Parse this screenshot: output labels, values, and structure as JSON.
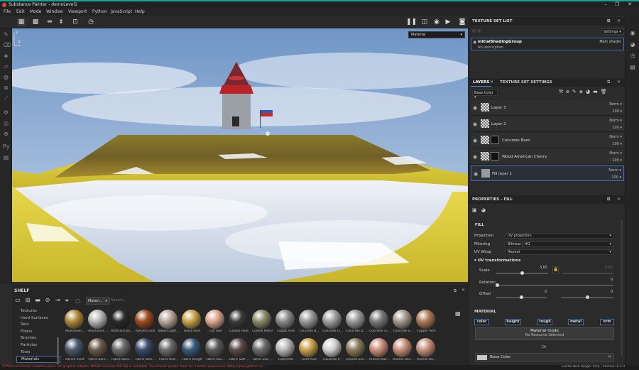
{
  "window": {
    "title": "Substance Painter - demoLevel1",
    "accent": "#1aa39a"
  },
  "menu": [
    "File",
    "Edit",
    "Mode",
    "Window",
    "Viewport",
    "Python",
    "JavaScript",
    "Help"
  ],
  "viewport": {
    "mode_select": "Material"
  },
  "shelf": {
    "title": "SHELF",
    "categories": [
      "Textures",
      "Hard Surfaces",
      "Skin",
      "Filters",
      "Brushes",
      "Particles",
      "Tools",
      "Materials"
    ],
    "selected_category": "Materials",
    "filter_chip": "Materi...",
    "search_placeholder": "Search...",
    "materials_row1": [
      "Aluminium...",
      "Aluminium ...",
      "Artificial Lea...",
      "Autumn Leaf",
      "Baked Light...",
      "Brass Pure",
      "Calf Skin",
      "Carbon Fiber",
      "Coated Metal",
      "Cobalt Pure",
      "Concrete B...",
      "Concrete Cl...",
      "Concrete D...",
      "Concrete Si...",
      "Concrete S...",
      "Copper Pure"
    ],
    "materials_row2": [
      "Denim Rivet",
      "Fabric Barn...",
      "Fabric Base...",
      "Fabric Deni...",
      "Fabric Knit...",
      "Fabric Rough",
      "Fabric Rou...",
      "Fabric Soft ...",
      "Fabric Suit ...",
      "Footprints",
      "Gold Pure",
      "Gouache P...",
      "Ground Gra...",
      "Human Bac...",
      "Human Bell...",
      "Human Bu..."
    ]
  },
  "status": {
    "message": "[GPUIssuesCheck] Installed driver for graphics adapter NVIDIA GeForce MX150 is outdated. You should update them for a better experience (http://www.geforce.co...",
    "cache_label": "Cache Disk Usage:",
    "cache_value": "95%",
    "version": "Version: 6.2.0"
  },
  "texture_set_list": {
    "title": "TEXTURE SET LIST",
    "settings_label": "Settings",
    "shading_group": "initialShadingGroup",
    "description": "No description",
    "shader": "Main shader"
  },
  "layers": {
    "tab_layers": "LAYERS",
    "tab_settings": "TEXTURE SET SETTINGS",
    "channel": "Base Color",
    "items": [
      {
        "name": "Layer 3",
        "blend": "Norm",
        "opacity": "100"
      },
      {
        "name": "Layer 2",
        "blend": "Norm",
        "opacity": "100"
      },
      {
        "name": "Concrete Bare",
        "blend": "Norm",
        "opacity": "100"
      },
      {
        "name": "Wood American Cherry",
        "blend": "Norm",
        "opacity": "100"
      },
      {
        "name": "Fill layer 1",
        "blend": "Norm",
        "opacity": "100"
      }
    ]
  },
  "properties": {
    "title": "PROPERTIES - FILL",
    "section_fill": "FILL",
    "projection_label": "Projection",
    "projection_value": "UV projection",
    "filtering_label": "Filtering",
    "filtering_value": "Bilinear | HQ",
    "uvwrap_label": "UV Wrap",
    "uvwrap_value": "Repeat",
    "uv_transform_title": "UV transformations",
    "scale_label": "Scale",
    "scale_value": "3.65",
    "scale_value2": "3.65",
    "scale_level": 0.5,
    "rotation_label": "Rotation",
    "rotation_value": "0",
    "offset_label": "Offset",
    "offset_value1": "0",
    "offset_value2": "0",
    "material_title": "MATERIAL",
    "channels": [
      "color",
      "height",
      "rough",
      "metal",
      "nrm"
    ],
    "material_mode_label": "Material mode",
    "no_resource": "No Resource Selected",
    "or_label": "Or",
    "base_color_label": "Base Color"
  }
}
